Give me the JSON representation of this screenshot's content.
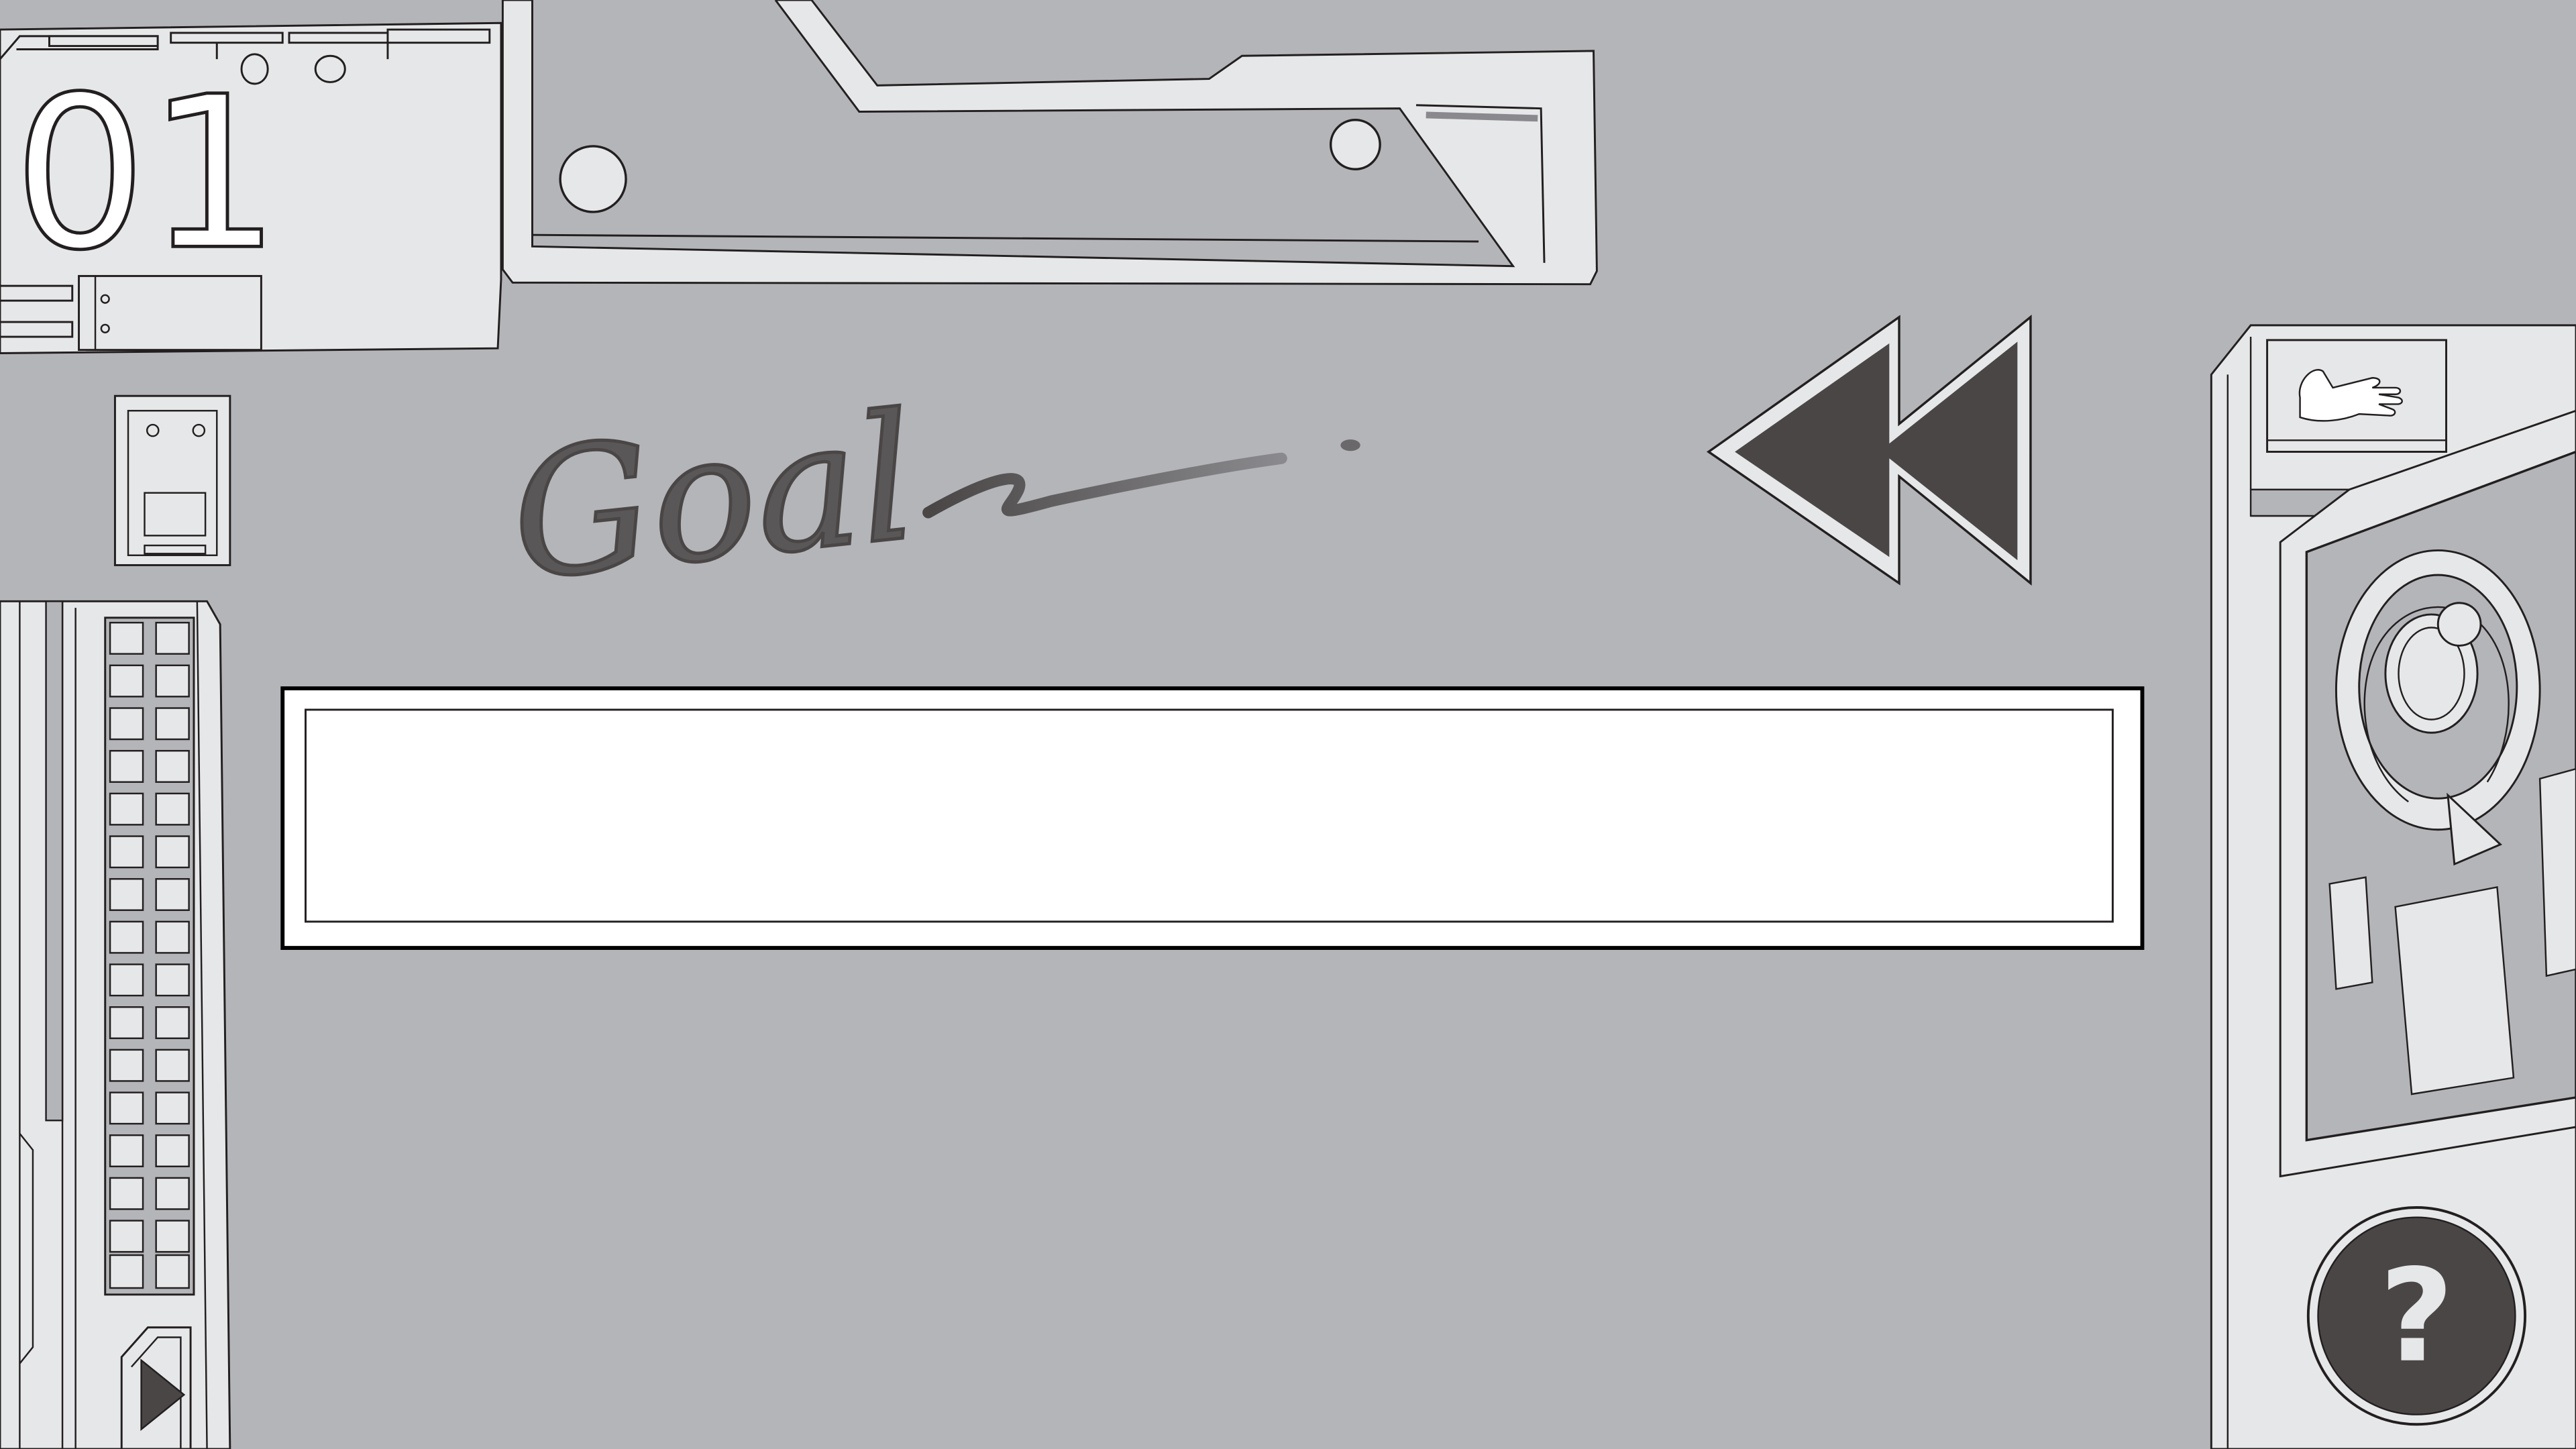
{
  "game": {
    "level_number": "01",
    "goal_label": "Goal",
    "goal_value": "",
    "help_label": "?"
  },
  "icons": {
    "rewind": "rewind-icon",
    "hand": "hand-icon",
    "restart": "restart-icon",
    "play": "play-icon",
    "help": "help-icon"
  },
  "colors": {
    "background": "#b4b5b9",
    "panel_light": "#e6e7e8",
    "dark": "#4a4646",
    "goal_box": "#ffffff"
  }
}
